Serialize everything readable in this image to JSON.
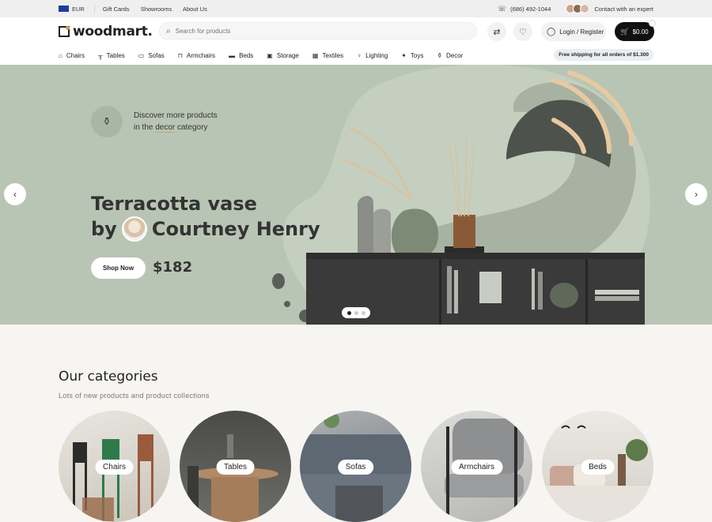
{
  "topbar": {
    "currency": "EUR",
    "links": [
      "Gift Cards",
      "Showrooms",
      "About Us"
    ],
    "phone": "(686) 492-1044",
    "contact": "Contact with an expert"
  },
  "header": {
    "logo": "woodmart.",
    "search_placeholder": "Search for products",
    "login_label": "Login / Register",
    "cart_total": "$0.00"
  },
  "nav": {
    "items": [
      {
        "label": "Chairs",
        "icon": "chair-icon"
      },
      {
        "label": "Tables",
        "icon": "table-icon"
      },
      {
        "label": "Sofas",
        "icon": "sofa-icon"
      },
      {
        "label": "Armchairs",
        "icon": "armchair-icon"
      },
      {
        "label": "Beds",
        "icon": "bed-icon"
      },
      {
        "label": "Storage",
        "icon": "storage-icon"
      },
      {
        "label": "Textiles",
        "icon": "textile-icon"
      },
      {
        "label": "Lighting",
        "icon": "lamp-icon"
      },
      {
        "label": "Toys",
        "icon": "toy-icon"
      },
      {
        "label": "Decor",
        "icon": "decor-icon"
      }
    ],
    "shipping": "Free shipping for all orders of $1.300"
  },
  "hero": {
    "discover_line1": "Discover more products",
    "discover_line2_pre": "in the ",
    "discover_line2_link": "decor",
    "discover_line2_post": " category",
    "title_line1": "Terracotta vase",
    "title_by": "by",
    "title_name": "Courtney Henry",
    "shop_label": "Shop Now",
    "price": "$182",
    "colors": {
      "bg": "#b9c5b4",
      "shelf": "#3a3a3a",
      "accent": "#e8c9a1"
    }
  },
  "categories": {
    "title": "Our categories",
    "subtitle": "Lots of new products and product collections",
    "items": [
      "Chairs",
      "Tables",
      "Sofas",
      "Armchairs",
      "Beds"
    ]
  }
}
